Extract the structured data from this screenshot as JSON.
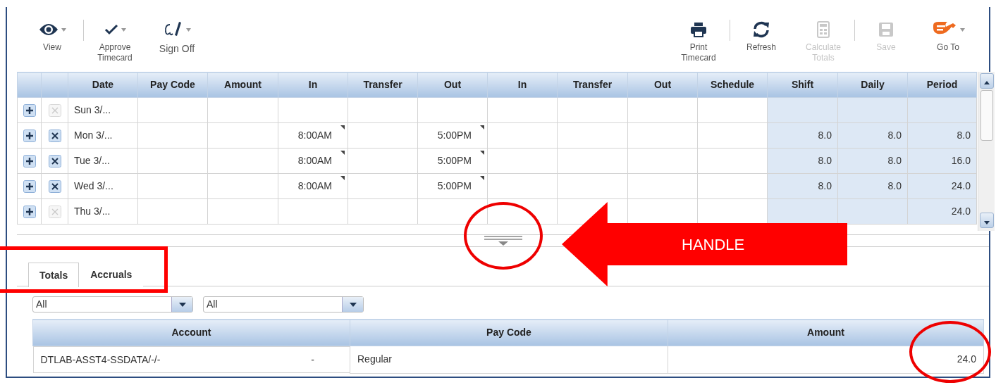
{
  "toolbar": {
    "left": [
      {
        "kind": "view",
        "label": "View",
        "dropdown": true,
        "disabled": false,
        "separator_after": true
      },
      {
        "kind": "approve",
        "label": "Approve Timecard",
        "dropdown": true,
        "disabled": false,
        "separator_after": false
      },
      {
        "kind": "sign",
        "label": "Sign Off",
        "dropdown": true,
        "disabled": false,
        "separator_after": false
      }
    ],
    "right": [
      {
        "kind": "print",
        "label": "Print Timecard",
        "dropdown": false,
        "disabled": false,
        "separator_after": true
      },
      {
        "kind": "refresh",
        "label": "Refresh",
        "dropdown": false,
        "disabled": false,
        "separator_after": false
      },
      {
        "kind": "calculate",
        "label": "Calculate Totals",
        "dropdown": false,
        "disabled": true,
        "separator_after": true
      },
      {
        "kind": "save",
        "label": "Save",
        "dropdown": false,
        "disabled": true,
        "separator_after": false
      },
      {
        "kind": "goto",
        "label": "Go To",
        "dropdown": true,
        "disabled": false,
        "separator_after": false
      }
    ]
  },
  "grid": {
    "columns": [
      "Date",
      "Pay Code",
      "Amount",
      "In",
      "Transfer",
      "Out",
      "In",
      "Transfer",
      "Out",
      "Schedule",
      "Shift",
      "Daily",
      "Period"
    ],
    "rows": [
      {
        "date": "Sun 3/...",
        "removable": false
      },
      {
        "date": "Mon 3/...",
        "in_1": "8:00AM",
        "out_1": "5:00PM",
        "shift": "8.0",
        "daily": "8.0",
        "period": "8.0",
        "removable": true
      },
      {
        "date": "Tue 3/...",
        "in_1": "8:00AM",
        "out_1": "5:00PM",
        "shift": "8.0",
        "daily": "8.0",
        "period": "16.0",
        "removable": true
      },
      {
        "date": "Wed 3/...",
        "in_1": "8:00AM",
        "out_1": "5:00PM",
        "shift": "8.0",
        "daily": "8.0",
        "period": "24.0",
        "removable": true
      },
      {
        "date": "Thu 3/...",
        "period": "24.0",
        "removable": false
      }
    ]
  },
  "bottom": {
    "tabs": [
      {
        "label": "Totals",
        "selected": true
      },
      {
        "label": "Accruals",
        "selected": false
      }
    ],
    "filters": [
      {
        "value": "All"
      },
      {
        "value": "All"
      }
    ],
    "totals": {
      "columns": [
        "Account",
        "Pay Code",
        "Amount"
      ],
      "rows": [
        {
          "account": "DTLAB-ASST4-SSDATA/-/-",
          "account_suffix": "-",
          "pay_code": "Regular",
          "amount": "24.0"
        }
      ]
    }
  },
  "annotations": [
    {
      "kind": "box"
    },
    {
      "kind": "circle"
    },
    {
      "kind": "arrow",
      "label": "HANDLE"
    },
    {
      "kind": "circle"
    }
  ]
}
